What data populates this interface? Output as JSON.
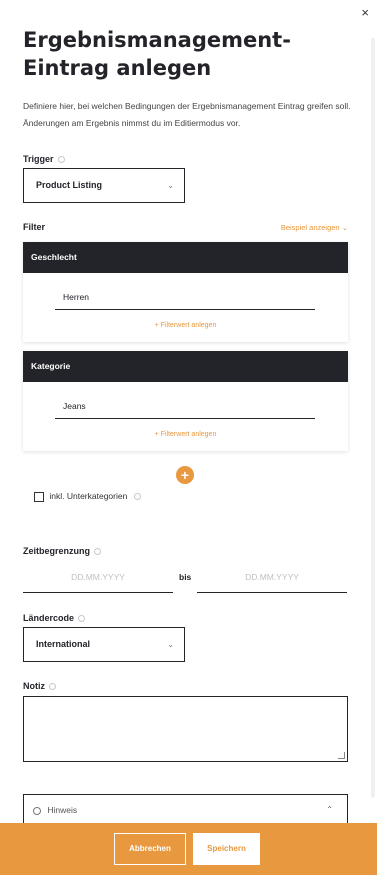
{
  "dialog": {
    "title": "Ergebnismanagement-Eintrag anlegen",
    "description": "Definiere hier, bei welchen Bedingungen der Ergebnismanagement Eintrag greifen soll. Änderungen am Ergebnis nimmst du im Editiermodus vor.",
    "close_icon": "×"
  },
  "trigger": {
    "label": "Trigger",
    "selected": "Product Listing"
  },
  "filter": {
    "label": "Filter",
    "example_link": "Beispiel anzeigen",
    "groups": [
      {
        "title": "Geschlecht",
        "value": "Herren",
        "add_label": "Filterwert anlegen"
      },
      {
        "title": "Kategorie",
        "value": "Jeans",
        "add_label": "Filterwert anlegen"
      }
    ],
    "add_group_icon": "+",
    "subcategories_label": "inkl. Unterkategorien"
  },
  "time_limit": {
    "label": "Zeitbegrenzung",
    "from_placeholder": "DD.MM.YYYY",
    "separator": "bis",
    "to_placeholder": "DD.MM.YYYY"
  },
  "country_code": {
    "label": "Ländercode",
    "selected": "International"
  },
  "note": {
    "label": "Notiz",
    "value": ""
  },
  "hint": {
    "label": "Hinweis"
  },
  "footer": {
    "cancel_label": "Abbrechen",
    "save_label": "Speichern"
  },
  "colors": {
    "accent": "#e8983e",
    "dark": "#23232a"
  }
}
